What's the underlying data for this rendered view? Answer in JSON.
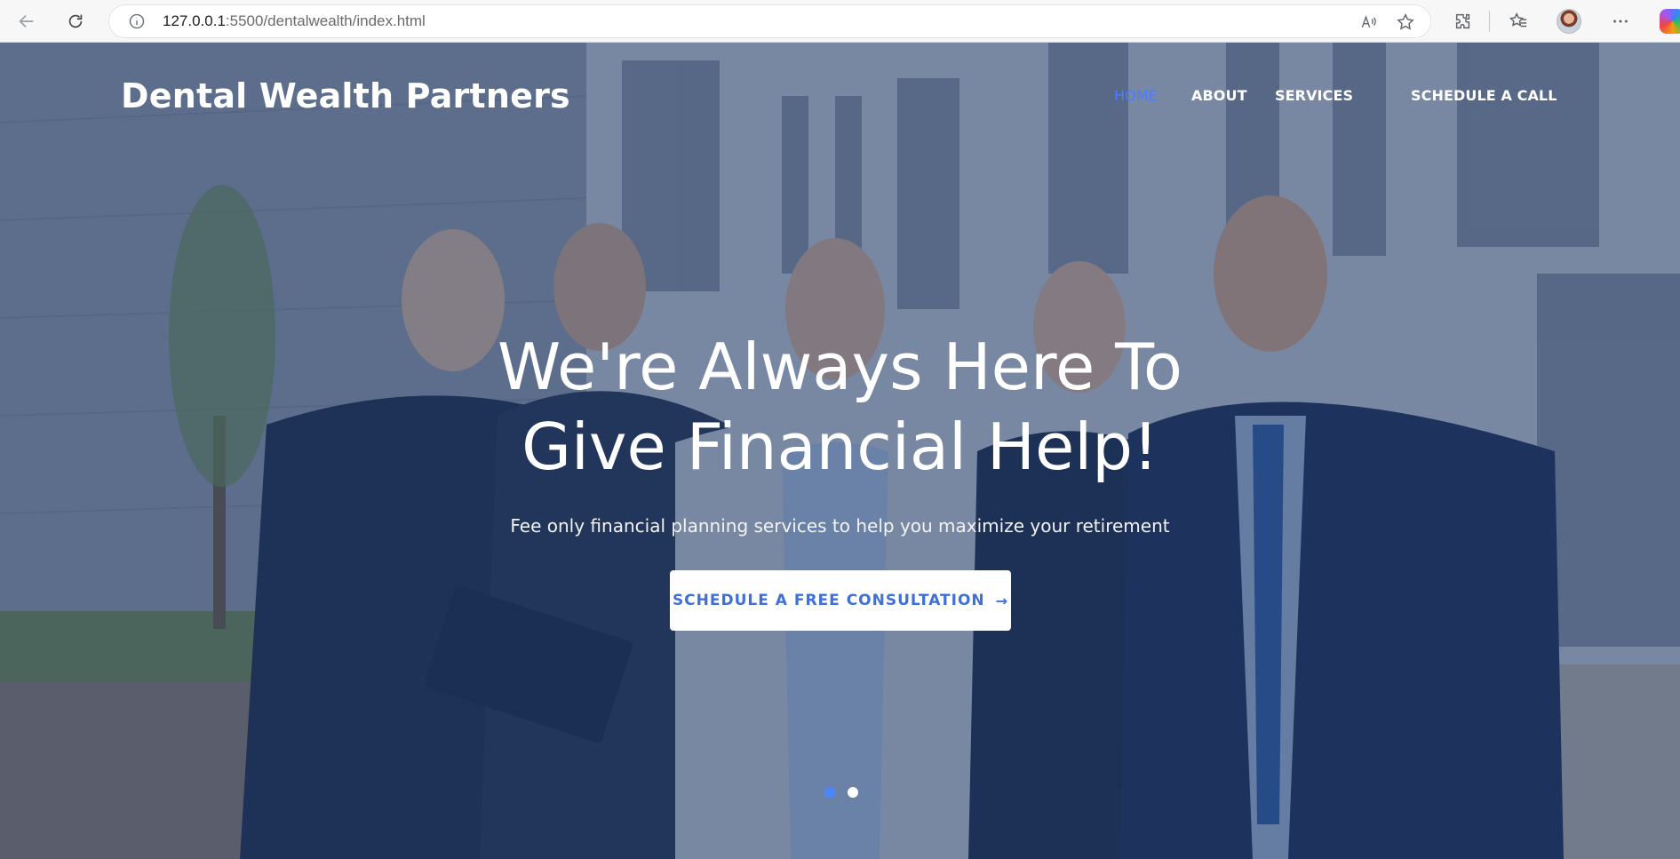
{
  "browser": {
    "url_host": "127.0.0.1",
    "url_rest": ":5500/dentalwealth/index.html"
  },
  "site": {
    "logo": "Dental Wealth Partners",
    "nav": {
      "home": "HOME",
      "about": "ABOUT",
      "services": "SERVICES",
      "schedule": "SCHEDULE A CALL"
    }
  },
  "hero": {
    "title_line1": "We're Always Here To",
    "title_line2": "Give Financial Help!",
    "subtitle": "Fee only financial planning services to help you maximize your retirement",
    "cta_label": "SCHEDULE A FREE CONSULTATION",
    "cta_arrow": "→",
    "slides_total": 2,
    "active_slide": 1
  },
  "colors": {
    "accent": "#4a86ff",
    "cta_text": "#3f6fd8",
    "overlay": "#1e3764"
  },
  "icons": [
    "back-icon",
    "reload-icon",
    "info-icon",
    "read-aloud-icon",
    "favorite-star-icon",
    "extensions-icon",
    "favorites-icon",
    "profile-avatar",
    "more-icon",
    "copilot-icon",
    "arrow-right-icon"
  ]
}
